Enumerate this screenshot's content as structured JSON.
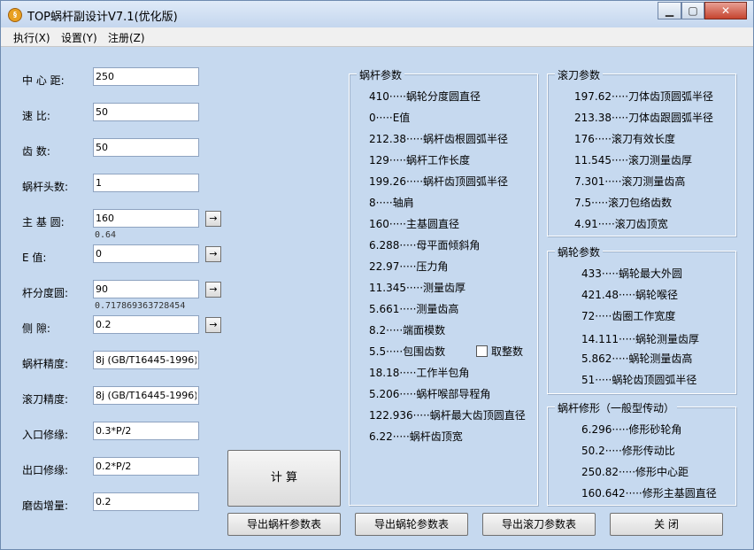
{
  "window": {
    "title": "TOP蜗杆副设计V7.1(优化版)",
    "icon_text": "§"
  },
  "menu": [
    {
      "label": "执行(X)"
    },
    {
      "label": "设置(Y)"
    },
    {
      "label": "注册(Z)"
    }
  ],
  "inputs": {
    "center_distance": {
      "label": "中 心 距:",
      "value": "250"
    },
    "speed_ratio": {
      "label": "速   比:",
      "value": "50"
    },
    "teeth": {
      "label": "齿   数:",
      "value": "50"
    },
    "worm_starts": {
      "label": "蜗杆头数:",
      "value": "1"
    },
    "main_base_circle": {
      "label": "主 基 圆:",
      "value": "160",
      "hint": "0.64"
    },
    "e_value": {
      "label": "E    值:",
      "value": "0"
    },
    "pitch_circle": {
      "label": "杆分度圆:",
      "value": "90",
      "hint": "0.717869363728454"
    },
    "backlash": {
      "label": "侧    隙:",
      "value": "0.2"
    },
    "worm_precision": {
      "label": "蜗杆精度:",
      "value": "8j (GB/T16445-1996)"
    },
    "hob_precision": {
      "label": "滚刀精度:",
      "value": "8j (GB/T16445-1996)"
    },
    "entry_trim": {
      "label": "入口修缘:",
      "value": "0.3*P/2"
    },
    "exit_trim": {
      "label": "出口修缘:",
      "value": "0.2*P/2"
    },
    "grind_allowance": {
      "label": "磨齿增量:",
      "value": "0.2"
    }
  },
  "arrow_glyph": "→",
  "worm_params": {
    "title": "蜗杆参数",
    "rows": [
      "410·····蜗轮分度圆直径",
      "0·····E值",
      "212.38·····蜗杆齿根圆弧半径",
      "129·····蜗杆工作长度",
      "199.26·····蜗杆齿顶圆弧半径",
      "8·····轴肩",
      "160·····主基圆直径",
      "6.288·····母平面倾斜角",
      "22.97·····压力角",
      "11.345·····测量齿厚",
      "5.661·····测量齿高",
      "8.2·····端面模数",
      "5.5·····包围齿数",
      "18.18·····工作半包角",
      "5.206·····蜗杆喉部导程角",
      "122.936·····蜗杆最大齿顶圆直径",
      "6.22·····蜗杆齿顶宽"
    ],
    "round_checkbox_label": "取整数"
  },
  "hob_params": {
    "title": "滚刀参数",
    "rows": [
      "197.62·····刀体齿顶圆弧半径",
      "213.38·····刀体齿跟圆弧半径",
      "176·····滚刀有效长度",
      "11.545·····滚刀测量齿厚",
      "7.301·····滚刀测量齿高",
      "7.5·····滚刀包络齿数",
      "4.91·····滚刀齿顶宽"
    ]
  },
  "wheel_params": {
    "title": "蜗轮参数",
    "rows": [
      "433·····蜗轮最大外圆",
      "421.48·····蜗轮喉径",
      "72·····齿圈工作宽度",
      "14.111·····蜗轮测量齿厚",
      "5.862·····蜗轮测量齿高",
      "51·····蜗轮齿顶圆弧半径"
    ]
  },
  "modify_params": {
    "title": "蜗杆修形（一般型传动）",
    "rows": [
      "6.296·····修形砂轮角",
      "50.2·····修形传动比",
      "250.82·····修形中心距",
      "160.642·····修形主基圆直径"
    ]
  },
  "buttons": {
    "calculate": "计  算",
    "export_worm": "导出蜗杆参数表",
    "export_wheel": "导出蜗轮参数表",
    "export_hob": "导出滚刀参数表",
    "close": "关    闭"
  }
}
